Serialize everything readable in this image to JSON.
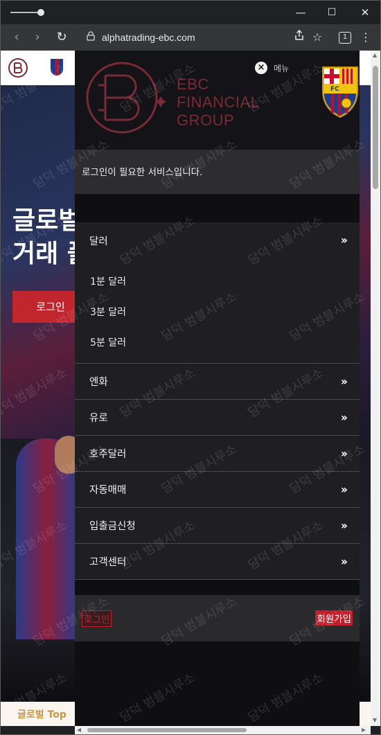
{
  "browser": {
    "url": "alphatrading-ebc.com",
    "tab_count": "1",
    "icons": [
      "back-icon",
      "forward-icon",
      "reload-icon",
      "lock-icon",
      "share-icon",
      "bookmark-star-icon",
      "more-icon"
    ]
  },
  "window": {
    "minimize": "—",
    "maximize": "☐",
    "close": "✕"
  },
  "hero": {
    "title": "글로벌 베스트\n거래 플랫폼",
    "login_label": "로그인",
    "bottom_title": "글로벌 Top"
  },
  "drawer": {
    "logo_line1": "EBC",
    "logo_line2": "FINANCIAL",
    "logo_line3": "GROUP",
    "crest_letters": "FC",
    "close_label": "×",
    "menu_label": "메뉴",
    "notice": "로그인이 필요한 서비스입니다.",
    "menu": {
      "dollar": "달러",
      "sub": [
        "1분 달러",
        "3분 달러",
        "5분 달러"
      ],
      "items": [
        "엔화",
        "유로",
        "호주달러",
        "자동매매",
        "입출금신청",
        "고객센터"
      ]
    },
    "login": "로그인",
    "signup": "회원가입"
  },
  "watermark": "담덕 범블시루소",
  "colors": {
    "accent": "#c21f2c",
    "drawer_bg": "#1f1f22",
    "logo": "#7a2a36"
  }
}
